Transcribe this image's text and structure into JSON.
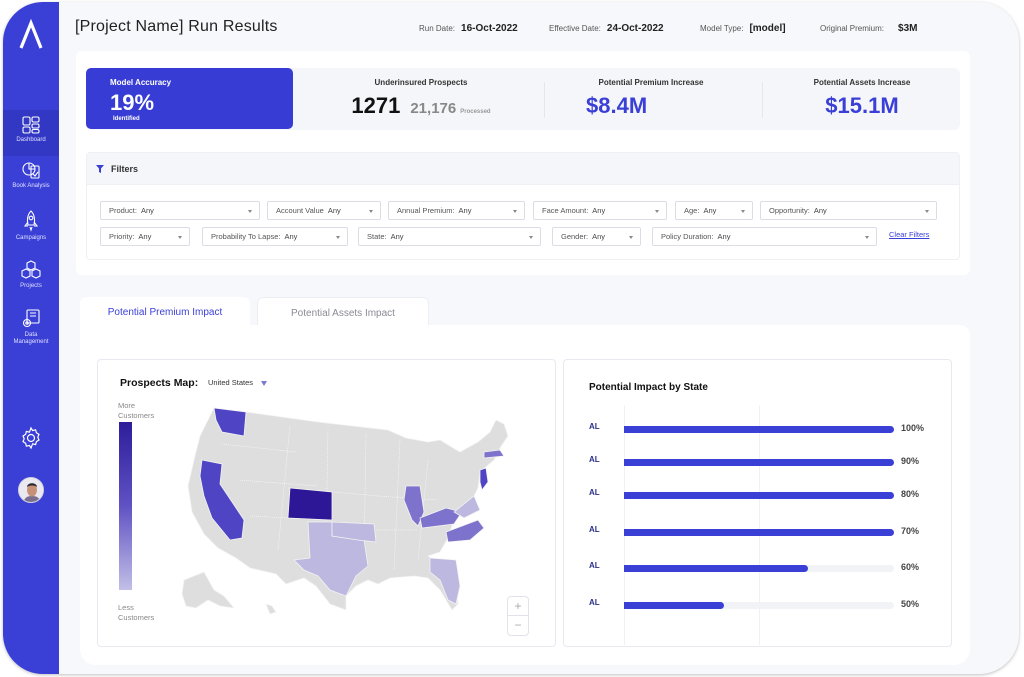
{
  "colors": {
    "brand": "#3a3fd6",
    "kpi_accent": "#373dd4",
    "map_base": "#dedede",
    "map_scale_high": "#2d1d9a",
    "map_scale_low": "#c2bfe6"
  },
  "sidebar": {
    "logo": "app-logo",
    "items": [
      {
        "label": "Dashboard",
        "icon": "grid-icon",
        "active": true
      },
      {
        "label": "Book Analysis",
        "icon": "pie-chart-icon",
        "active": false
      },
      {
        "label": "Campaigns",
        "icon": "rocket-icon",
        "active": false
      },
      {
        "label": "Projects",
        "icon": "cubes-icon",
        "active": false
      },
      {
        "label": "Data Management",
        "icon": "data-gear-icon",
        "active": false
      }
    ],
    "settings_icon": "gear-icon",
    "avatar": "user-avatar"
  },
  "header": {
    "title": "[Project Name] Run Results",
    "run_date_label": "Run Date:",
    "run_date": "16-Oct-2022",
    "effective_date_label": "Effective Date:",
    "effective_date": "24-Oct-2022",
    "model_type_label": "Model Type:",
    "model_type": "[model]",
    "original_premium_label": "Original Premium:",
    "original_premium": "$3M"
  },
  "kpis": {
    "accuracy": {
      "label": "Model Accuracy",
      "value": "19%",
      "sub": "Identified"
    },
    "underinsured": {
      "label": "Underinsured Prospects",
      "value": "1271",
      "processed": "21,176",
      "processed_label": "Processed"
    },
    "premium_increase": {
      "label": "Potential Premium Increase",
      "value": "$8.4M"
    },
    "assets_increase": {
      "label": "Potential Assets Increase",
      "value": "$15.1M"
    }
  },
  "filters": {
    "title": "Filters",
    "clear_label": "Clear Filters",
    "items": [
      {
        "key": "Product:",
        "value": "Any"
      },
      {
        "key": "Account Value",
        "value": "Any"
      },
      {
        "key": "Annual Premium:",
        "value": "Any"
      },
      {
        "key": "Face Amount:",
        "value": "Any"
      },
      {
        "key": "Age:",
        "value": "Any"
      },
      {
        "key": "Opportunity:",
        "value": "Any"
      },
      {
        "key": "Priority:",
        "value": "Any"
      },
      {
        "key": "Probability To Lapse:",
        "value": "Any"
      },
      {
        "key": "State:",
        "value": "Any"
      },
      {
        "key": "Gender:",
        "value": "Any"
      },
      {
        "key": "Policy Duration:",
        "value": "Any"
      }
    ]
  },
  "tabs": [
    {
      "label": "Potential Premium Impact",
      "active": true
    },
    {
      "label": "Potential Assets Impact",
      "active": false
    }
  ],
  "map": {
    "title": "Prospects Map:",
    "region": "United States",
    "legend_high": "More Customers",
    "legend_low": "Less Customers",
    "zoom_in": "+",
    "zoom_out": "−",
    "highlighted_states": [
      {
        "state": "CO",
        "level": "highest"
      },
      {
        "state": "WA",
        "level": "high"
      },
      {
        "state": "CA",
        "level": "high"
      },
      {
        "state": "NJ",
        "level": "high"
      },
      {
        "state": "IL",
        "level": "medium"
      },
      {
        "state": "KY",
        "level": "medium"
      },
      {
        "state": "NC",
        "level": "medium"
      },
      {
        "state": "MA",
        "level": "medium"
      },
      {
        "state": "VA",
        "level": "low"
      },
      {
        "state": "TX",
        "level": "low"
      },
      {
        "state": "OK",
        "level": "low"
      },
      {
        "state": "FL",
        "level": "low"
      }
    ]
  },
  "impact_by_state": {
    "title": "Potential Impact by State",
    "rows": [
      {
        "state": "AL",
        "value_label": "100%",
        "fill": 1.0
      },
      {
        "state": "AL",
        "value_label": "90%",
        "fill": 1.0
      },
      {
        "state": "AL",
        "value_label": "80%",
        "fill": 1.0
      },
      {
        "state": "AL",
        "value_label": "70%",
        "fill": 1.0
      },
      {
        "state": "AL",
        "value_label": "60%",
        "fill": 0.68
      },
      {
        "state": "AL",
        "value_label": "50%",
        "fill": 0.37
      }
    ]
  }
}
